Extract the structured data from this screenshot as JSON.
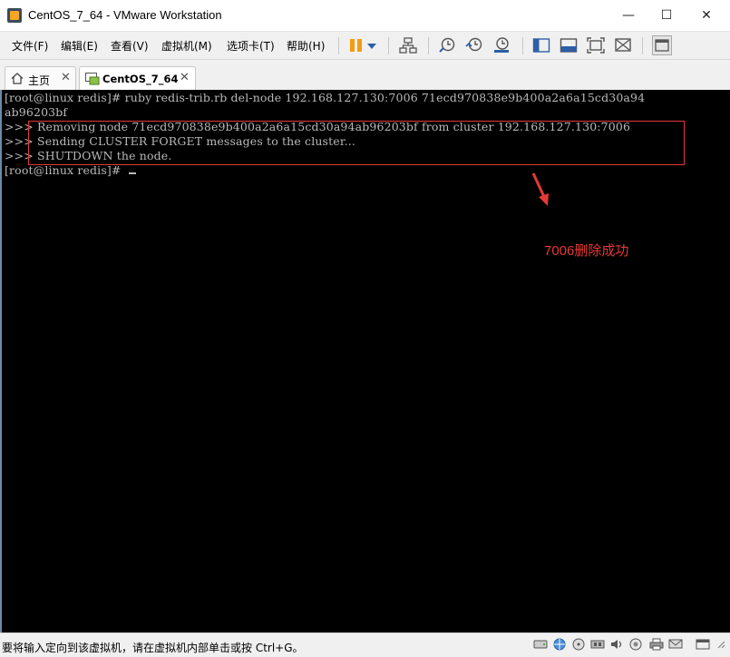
{
  "window": {
    "title": "CentOS_7_64 - VMware Workstation",
    "controls": {
      "minimize": "—",
      "maximize": "☐",
      "close": "✕"
    }
  },
  "menu": {
    "items": [
      "文件(F)",
      "编辑(E)",
      "查看(V)",
      "虚拟机(M)",
      "选项卡(T)",
      "帮助(H)"
    ]
  },
  "toolbar": {
    "icons": [
      "pause-icon",
      "dropdown-icon",
      "network-icon",
      "snapshot-icon",
      "revert-snapshot-icon",
      "snapshot-manager-icon",
      "console-view-icon",
      "fit-guest-icon",
      "fullscreen-icon",
      "unity-icon",
      "library-icon"
    ]
  },
  "tabs": [
    {
      "label": "主页",
      "icon": "home-icon",
      "close": "✕",
      "active": false
    },
    {
      "label": "CentOS_7_64",
      "icon": "vm-icon",
      "close": "✕",
      "active": true
    }
  ],
  "terminal": {
    "lines": [
      "[root@linux redis]# ruby redis-trib.rb del-node 192.168.127.130:7006 71ecd970838e9b400a2a6a15cd30a94",
      "ab96203bf",
      ">>> Removing node 71ecd970838e9b400a2a6a15cd30a94ab96203bf from cluster 192.168.127.130:7006",
      ">>> Sending CLUSTER FORGET messages to the cluster...",
      ">>> SHUTDOWN the node.",
      "[root@linux redis]# "
    ],
    "annotation": "7006删除成功",
    "annotation_color": "#e53935",
    "highlight_color": "#e53935"
  },
  "status": {
    "text": "要将输入定向到该虚拟机，请在虚拟机内部单击或按 Ctrl+G。",
    "icons": [
      "hdd-icon",
      "network-icon",
      "cdrom-icon",
      "usb-icon",
      "sound-icon",
      "display-icon",
      "printer-icon",
      "message-icon"
    ]
  }
}
